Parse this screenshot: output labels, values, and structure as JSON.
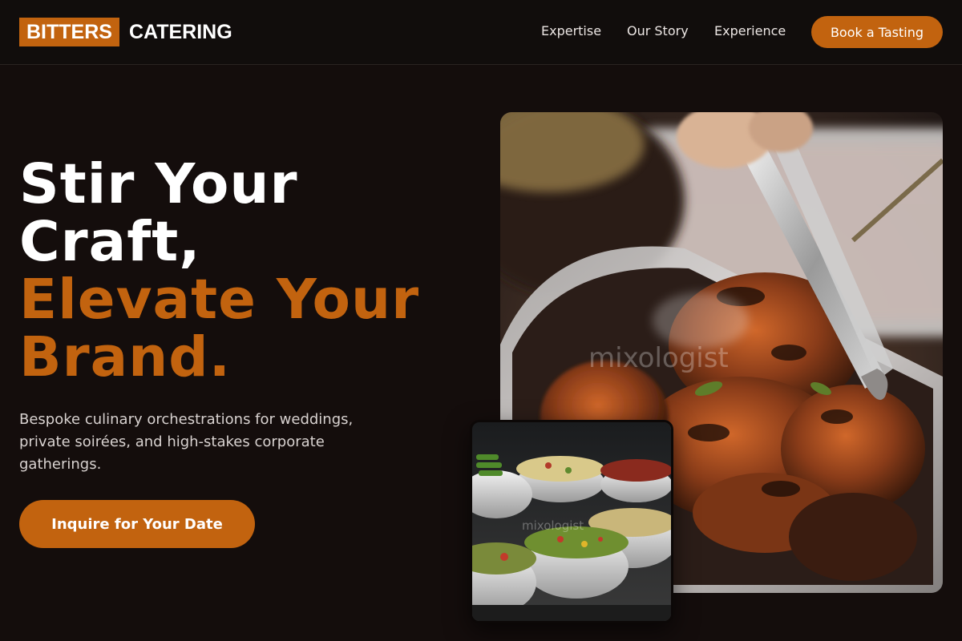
{
  "header": {
    "logo_box": "BITTERS",
    "logo_text": "CATERING",
    "nav": [
      "Expertise",
      "Our Story",
      "Experience"
    ],
    "cta": "Book a Tasting"
  },
  "hero": {
    "title_line1": "Stir Your",
    "title_line2": "Craft,",
    "title_line3": "Elevate Your",
    "title_line4": "Brand.",
    "subtitle": "Bespoke culinary orchestrations for weddings, private soirées, and high-stakes corporate gatherings.",
    "cta": "Inquire for Your Date"
  },
  "images": {
    "main_watermark": "mixologist",
    "small_watermark": "mixologist"
  },
  "colors": {
    "accent": "#c2630f",
    "background": "#140d0c"
  }
}
